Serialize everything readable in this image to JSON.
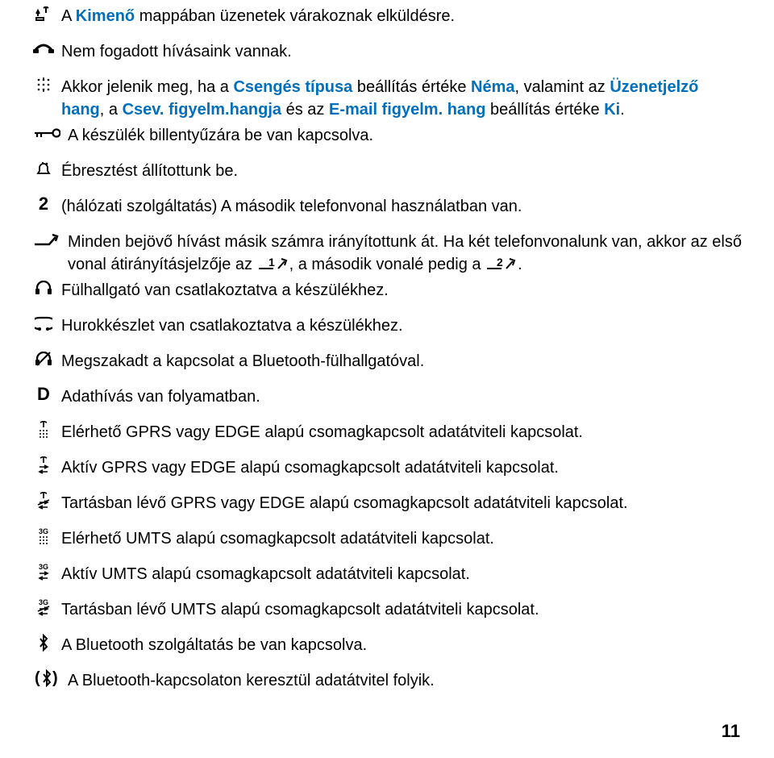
{
  "items": {
    "i1_pre": "A ",
    "i1_link": "Kimenő",
    "i1_post": " mappában üzenetek várakoznak elküldésre.",
    "i2": "Nem fogadott hívásaink vannak.",
    "i3_pre": "Akkor jelenik meg, ha a ",
    "i3_l1": "Csengés típusa",
    "i3_mid1": " beállítás értéke ",
    "i3_l2": "Néma",
    "i3_mid2": ", valamint az ",
    "i3_l3": "Üzenetjelző hang",
    "i3_mid3": ", a ",
    "i3_l4": "Csev. figyelm.hangja",
    "i3_mid4": " és az ",
    "i3_l5": "E-mail figyelm. hang",
    "i3_mid5": " beállítás értéke ",
    "i3_l6": "Ki",
    "i3_post": ".",
    "i4": "A készülék billentyűzára be van kapcsolva.",
    "i5": "Ébresztést állítottunk be.",
    "i6": "(hálózati szolgáltatás) A második telefonvonal használatban van.",
    "i7": "Minden bejövő hívást másik számra irányítottunk át. Ha két telefonvonalunk van, akkor az első vonal átirányításjelzője az ",
    "i7_mid": ", a második vonalé pedig a ",
    "i7_post": ".",
    "i8": "Fülhallgató van csatlakoztatva a készülékhez.",
    "i9": "Hurokkészlet van csatlakoztatva a készülékhez.",
    "i10": "Megszakadt a kapcsolat a Bluetooth-fülhallgatóval.",
    "i11": "Adathívás van folyamatban.",
    "i12": "Elérhető GPRS vagy EDGE alapú csomagkapcsolt adatátviteli kapcsolat.",
    "i13": "Aktív GPRS vagy EDGE alapú csomagkapcsolt adatátviteli kapcsolat.",
    "i14": "Tartásban lévő GPRS vagy EDGE alapú csomagkapcsolt adatátviteli kapcsolat.",
    "i15": "Elérhető UMTS alapú csomagkapcsolt adatátviteli kapcsolat.",
    "i16": "Aktív UMTS alapú csomagkapcsolt adatátviteli kapcsolat.",
    "i17": "Tartásban lévő UMTS alapú csomagkapcsolt adatátviteli kapcsolat.",
    "i18": "A Bluetooth szolgáltatás be van kapcsolva.",
    "i19": "A Bluetooth-kapcsolaton keresztül adatátvitel folyik."
  },
  "page_number": "11"
}
